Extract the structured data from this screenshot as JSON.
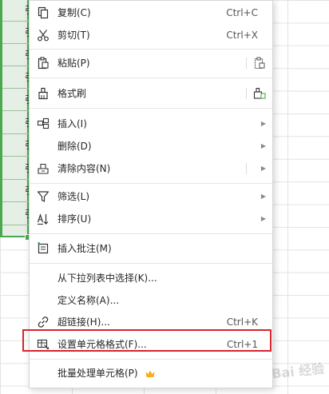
{
  "selected_cells": [
    "引",
    "引",
    "引",
    "引",
    "引",
    "引",
    "引",
    "引",
    "引",
    "引"
  ],
  "menu": {
    "copy": {
      "label": "复制(C)",
      "shortcut": "Ctrl+C"
    },
    "cut": {
      "label": "剪切(T)",
      "shortcut": "Ctrl+X"
    },
    "paste": {
      "label": "粘贴(P)"
    },
    "format_painter": {
      "label": "格式刷"
    },
    "insert": {
      "label": "插入(I)"
    },
    "delete": {
      "label": "删除(D)"
    },
    "clear_contents": {
      "label": "清除内容(N)"
    },
    "filter": {
      "label": "筛选(L)"
    },
    "sort": {
      "label": "排序(U)"
    },
    "insert_comment": {
      "label": "插入批注(M)"
    },
    "pick_from_list": {
      "label": "从下拉列表中选择(K)..."
    },
    "define_name": {
      "label": "定义名称(A)..."
    },
    "hyperlink": {
      "label": "超链接(H)...",
      "shortcut": "Ctrl+K"
    },
    "format_cells": {
      "label": "设置单元格格式(F)...",
      "shortcut": "Ctrl+1"
    },
    "batch_process": {
      "label": "批量处理单元格(P)"
    }
  },
  "watermark": "Bai 经验",
  "colors": {
    "selection_border": "#4aa84e",
    "highlight_border": "#d9232d",
    "crown": "#f2b01e"
  }
}
